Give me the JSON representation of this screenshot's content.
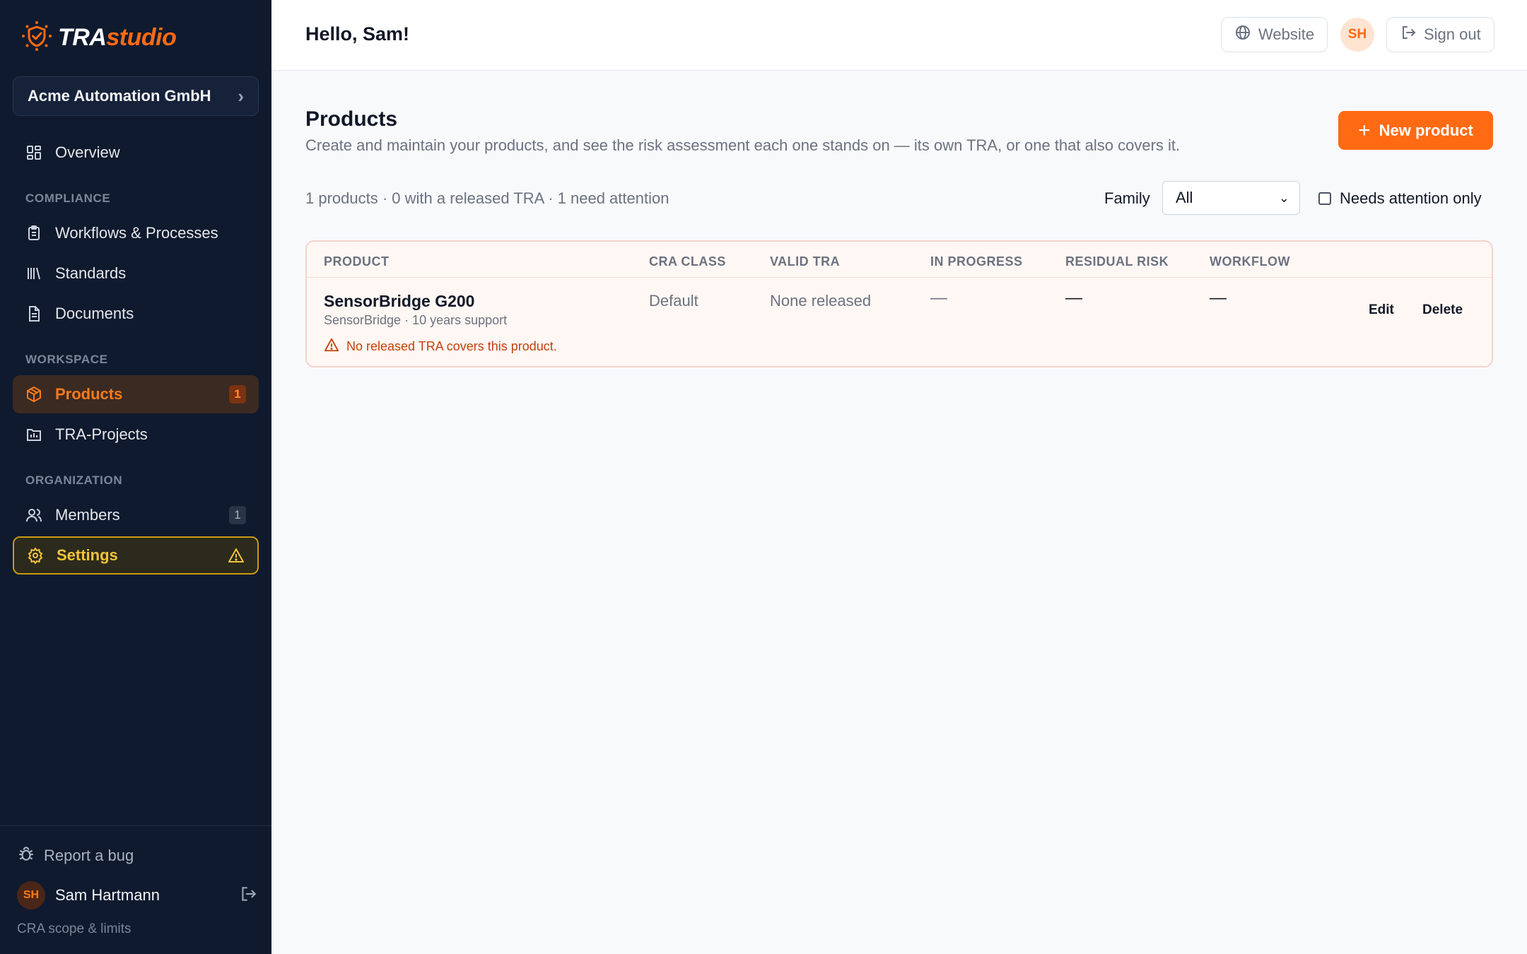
{
  "brand": {
    "name_tra": "TRA",
    "name_studio": "studio",
    "accent": "#ff6a13"
  },
  "org": {
    "name": "Acme Automation GmbH"
  },
  "nav": {
    "overview": "Overview",
    "section_compliance": "COMPLIANCE",
    "workflows": "Workflows & Processes",
    "standards": "Standards",
    "documents": "Documents",
    "section_workspace": "WORKSPACE",
    "products": "Products",
    "products_badge": "1",
    "tra_projects": "TRA-Projects",
    "section_organization": "ORGANIZATION",
    "members": "Members",
    "members_badge": "1",
    "settings": "Settings"
  },
  "footer": {
    "report_bug": "Report a bug",
    "user_initials": "SH",
    "user_name": "Sam Hartmann",
    "cra_scope": "CRA scope & limits"
  },
  "header": {
    "greeting": "Hello, Sam!",
    "website": "Website",
    "avatar_initials": "SH",
    "sign_out": "Sign out"
  },
  "page": {
    "title": "Products",
    "description": "Create and maintain your products, and see the risk assessment each one stands on — its own TRA, or one that also covers it.",
    "new_product": "New product",
    "summary": "1 products · 0 with a released TRA · 1 need attention",
    "family_label": "Family",
    "family_value": "All",
    "needs_attention_label": "Needs attention only"
  },
  "table": {
    "columns": [
      "PRODUCT",
      "CRA CLASS",
      "VALID TRA",
      "IN PROGRESS",
      "RESIDUAL RISK",
      "WORKFLOW"
    ],
    "rows": [
      {
        "name": "SensorBridge G200",
        "subtitle": "SensorBridge · 10 years support",
        "warning": "No released TRA covers this product.",
        "cra_class": "Default",
        "valid_tra": "None released",
        "in_progress": "—",
        "residual_risk": "—",
        "workflow": "—",
        "edit": "Edit",
        "delete": "Delete"
      }
    ]
  }
}
